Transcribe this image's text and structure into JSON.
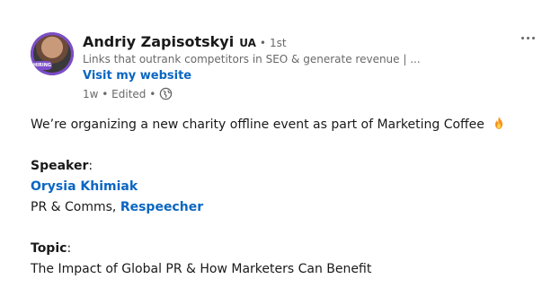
{
  "post": {
    "author": {
      "name": "Andriy Zapisotskyi",
      "country": "UA",
      "separator": "•",
      "degree": "1st",
      "headline": "Links that outrank competitors in SEO & generate revenue | ...",
      "website_label": "Visit my website",
      "meta": "1w • Edited •",
      "avatar_badge": "HIRING"
    },
    "content": {
      "intro": "We’re organizing a new charity offline event as part of Marketing Coffee",
      "speaker_heading": "Speaker",
      "speaker_name": "Orysia Khimiak",
      "speaker_role": "PR & Comms,",
      "speaker_company": "Respeecher",
      "topic_heading": "Topic",
      "topic_text": "The Impact of Global PR & How Marketers Can Benefit",
      "colon": ":"
    },
    "icons": {
      "more": "more-horizontal-icon",
      "globe": "globe-icon",
      "fire": "fire-emoji-icon"
    },
    "colors": {
      "link": "#0a66c2",
      "secondary_text": "rgba(0,0,0,0.6)",
      "primary_text": "rgba(0,0,0,0.9)"
    }
  }
}
